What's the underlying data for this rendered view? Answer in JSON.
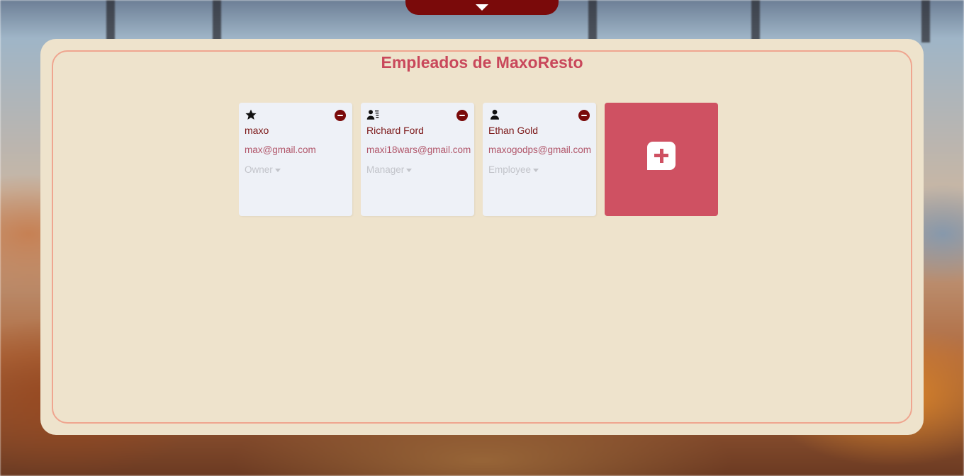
{
  "page": {
    "title": "Empleados de MaxoResto"
  },
  "colors": {
    "accent": "#c9485b",
    "dark_red": "#7a0a0a",
    "panel_bg": "#eee3cc",
    "add_card_bg": "#cf5162"
  },
  "employees": [
    {
      "name": "maxo",
      "email": "max@gmail.com",
      "role": "Owner",
      "icon": "star-icon"
    },
    {
      "name": "Richard Ford",
      "email": "maxi18wars@gmail.com",
      "role": "Manager",
      "icon": "user-list-icon"
    },
    {
      "name": "Ethan Gold",
      "email": "maxogodps@gmail.com",
      "role": "Employee",
      "icon": "user-icon"
    }
  ],
  "add_card": {
    "icon": "plus-square-icon"
  },
  "pull_tab": {
    "icon": "triangle-down-icon"
  }
}
